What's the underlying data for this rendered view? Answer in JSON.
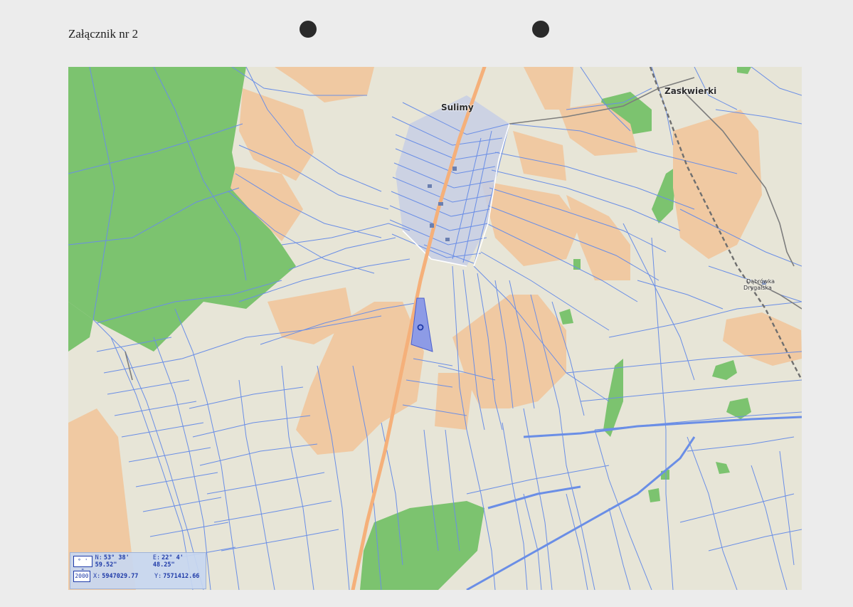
{
  "page_label": "Załącznik nr 2",
  "map": {
    "places": {
      "sulimy": "Sulimy",
      "zaskwierki": "Zaskwierki",
      "dabrowka_line1": "Dąbrówka",
      "dabrowka_line2": "Drygalska"
    },
    "road_number": "",
    "parcel_marker_symbol": "o",
    "colors": {
      "background": "#e7e5d7",
      "forest": "#7cc36f",
      "arable": "#f0c9a2",
      "built_up": "#c7cfe5",
      "parcel_border": "#6a8ee6",
      "road_main": "#f5b07a",
      "railway": "#6f6f6f",
      "parcel_highlight": "#8d9be6"
    }
  },
  "coordinates_panel": {
    "row1_badge": "° ' \"",
    "row2_badge": "2000",
    "n_key": "N:",
    "n_value": "53° 38' 59.52\"",
    "e_key": "E:",
    "e_value": "22° 4' 48.25\"",
    "x_key": "X:",
    "x_value": "5947029.77",
    "y_key": "Y:",
    "y_value": "7571412.66"
  }
}
